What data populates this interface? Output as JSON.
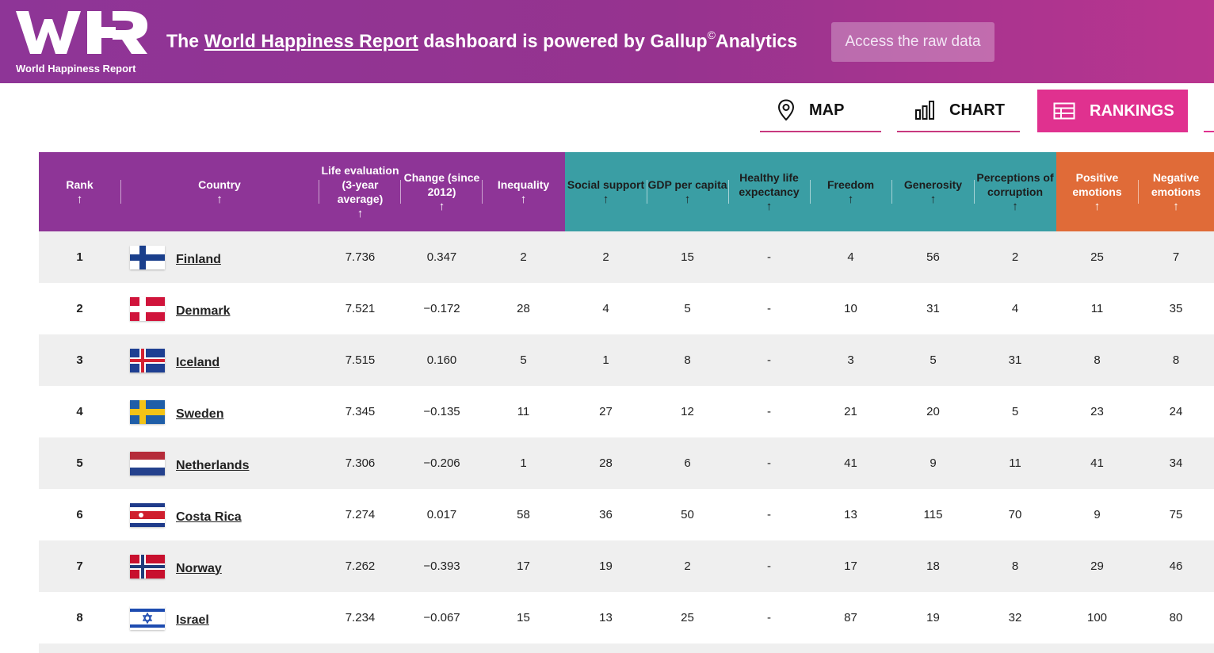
{
  "header": {
    "logo_text": "World Happiness Report",
    "tagline_before": "The ",
    "tagline_link": "World Happiness Report",
    "tagline_middle": " dashboard is powered by Gallup",
    "tagline_sup": "©",
    "tagline_after": "Analytics",
    "raw_data_button": "Access the raw data",
    "colors": {
      "banner": "#8e3597",
      "accent_pink": "#e0318f"
    }
  },
  "tabs": [
    {
      "label": "MAP",
      "icon": "map-pin-icon",
      "active": false
    },
    {
      "label": "CHART",
      "icon": "bar-chart-icon",
      "active": false
    },
    {
      "label": "RANKINGS",
      "icon": "table-icon",
      "active": true
    }
  ],
  "columns": [
    {
      "key": "rank",
      "label": "Rank",
      "group": "purple"
    },
    {
      "key": "country",
      "label": "Country",
      "group": "purple"
    },
    {
      "key": "life_eval",
      "label": "Life evaluation (3-year average)",
      "group": "purple"
    },
    {
      "key": "change",
      "label": "Change (since 2012)",
      "group": "purple"
    },
    {
      "key": "inequality",
      "label": "Inequality",
      "group": "purple"
    },
    {
      "key": "social",
      "label": "Social support",
      "group": "teal"
    },
    {
      "key": "gdp",
      "label": "GDP per capita",
      "group": "teal"
    },
    {
      "key": "health",
      "label": "Healthy life expectancy",
      "group": "teal"
    },
    {
      "key": "freedom",
      "label": "Freedom",
      "group": "teal"
    },
    {
      "key": "generosity",
      "label": "Generosity",
      "group": "teal"
    },
    {
      "key": "corruption",
      "label": "Perceptions of corruption",
      "group": "teal"
    },
    {
      "key": "positive",
      "label": "Positive emotions",
      "group": "orange"
    },
    {
      "key": "negative",
      "label": "Negative emotions",
      "group": "orange"
    }
  ],
  "sort_arrow": "↑",
  "group_colors": {
    "purple": "#8e3597",
    "teal": "#3a9ea4",
    "orange": "#e06b38"
  },
  "rows": [
    {
      "rank": "1",
      "country": "Finland",
      "flag": "finland",
      "life_eval": "7.736",
      "change": "0.347",
      "inequality": "2",
      "social": "2",
      "gdp": "15",
      "health": "-",
      "freedom": "4",
      "generosity": "56",
      "corruption": "2",
      "positive": "25",
      "negative": "7"
    },
    {
      "rank": "2",
      "country": "Denmark",
      "flag": "denmark",
      "life_eval": "7.521",
      "change": "−0.172",
      "inequality": "28",
      "social": "4",
      "gdp": "5",
      "health": "-",
      "freedom": "10",
      "generosity": "31",
      "corruption": "4",
      "positive": "11",
      "negative": "35"
    },
    {
      "rank": "3",
      "country": "Iceland",
      "flag": "iceland",
      "life_eval": "7.515",
      "change": "0.160",
      "inequality": "5",
      "social": "1",
      "gdp": "8",
      "health": "-",
      "freedom": "3",
      "generosity": "5",
      "corruption": "31",
      "positive": "8",
      "negative": "8"
    },
    {
      "rank": "4",
      "country": "Sweden",
      "flag": "sweden",
      "life_eval": "7.345",
      "change": "−0.135",
      "inequality": "11",
      "social": "27",
      "gdp": "12",
      "health": "-",
      "freedom": "21",
      "generosity": "20",
      "corruption": "5",
      "positive": "23",
      "negative": "24"
    },
    {
      "rank": "5",
      "country": "Netherlands",
      "flag": "netherlands",
      "life_eval": "7.306",
      "change": "−0.206",
      "inequality": "1",
      "social": "28",
      "gdp": "6",
      "health": "-",
      "freedom": "41",
      "generosity": "9",
      "corruption": "11",
      "positive": "41",
      "negative": "34"
    },
    {
      "rank": "6",
      "country": "Costa Rica",
      "flag": "costa-rica",
      "life_eval": "7.274",
      "change": "0.017",
      "inequality": "58",
      "social": "36",
      "gdp": "50",
      "health": "-",
      "freedom": "13",
      "generosity": "115",
      "corruption": "70",
      "positive": "9",
      "negative": "75"
    },
    {
      "rank": "7",
      "country": "Norway",
      "flag": "norway",
      "life_eval": "7.262",
      "change": "−0.393",
      "inequality": "17",
      "social": "19",
      "gdp": "2",
      "health": "-",
      "freedom": "17",
      "generosity": "18",
      "corruption": "8",
      "positive": "29",
      "negative": "46"
    },
    {
      "rank": "8",
      "country": "Israel",
      "flag": "israel",
      "life_eval": "7.234",
      "change": "−0.067",
      "inequality": "15",
      "social": "13",
      "gdp": "25",
      "health": "-",
      "freedom": "87",
      "generosity": "19",
      "corruption": "32",
      "positive": "100",
      "negative": "80"
    }
  ]
}
